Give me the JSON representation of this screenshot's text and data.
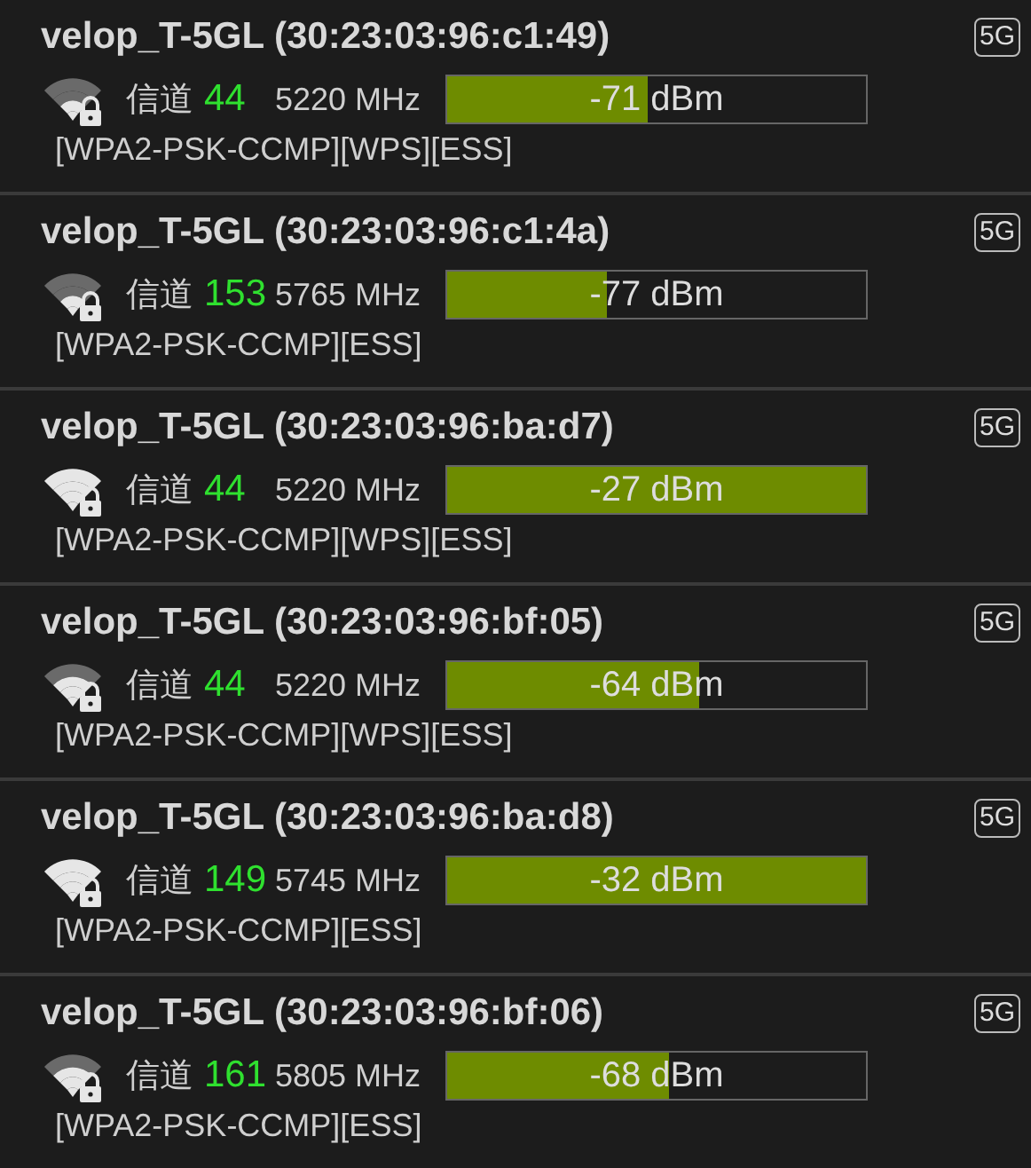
{
  "networks": [
    {
      "title": "velop_T-5GL (30:23:03:96:c1:49)",
      "band": "5G",
      "channel_label": "信道",
      "channel": "44",
      "frequency": "5220 MHz",
      "level": 0.48,
      "reading": "-71 dBm",
      "security": "[WPA2-PSK-CCMP][WPS][ESS]"
    },
    {
      "title": "velop_T-5GL (30:23:03:96:c1:4a)",
      "band": "5G",
      "channel_label": "信道",
      "channel": "153",
      "frequency": "5765 MHz",
      "level": 0.38,
      "reading": "-77 dBm",
      "security": "[WPA2-PSK-CCMP][ESS]"
    },
    {
      "title": "velop_T-5GL (30:23:03:96:ba:d7)",
      "band": "5G",
      "channel_label": "信道",
      "channel": "44",
      "frequency": "5220 MHz",
      "level": 1,
      "reading": "-27 dBm",
      "security": "[WPA2-PSK-CCMP][WPS][ESS]"
    },
    {
      "title": "velop_T-5GL (30:23:03:96:bf:05)",
      "band": "5G",
      "channel_label": "信道",
      "channel": "44",
      "frequency": "5220 MHz",
      "level": 0.6,
      "reading": "-64 dBm",
      "security": "[WPA2-PSK-CCMP][WPS][ESS]"
    },
    {
      "title": "velop_T-5GL (30:23:03:96:ba:d8)",
      "band": "5G",
      "channel_label": "信道",
      "channel": "149",
      "frequency": "5745 MHz",
      "level": 1,
      "reading": "-32 dBm",
      "security": "[WPA2-PSK-CCMP][ESS]"
    },
    {
      "title": "velop_T-5GL (30:23:03:96:bf:06)",
      "band": "5G",
      "channel_label": "信道",
      "channel": "161",
      "frequency": "5805 MHz",
      "level": 0.53,
      "reading": "-68 dBm",
      "security": "[WPA2-PSK-CCMP][ESS]"
    }
  ]
}
